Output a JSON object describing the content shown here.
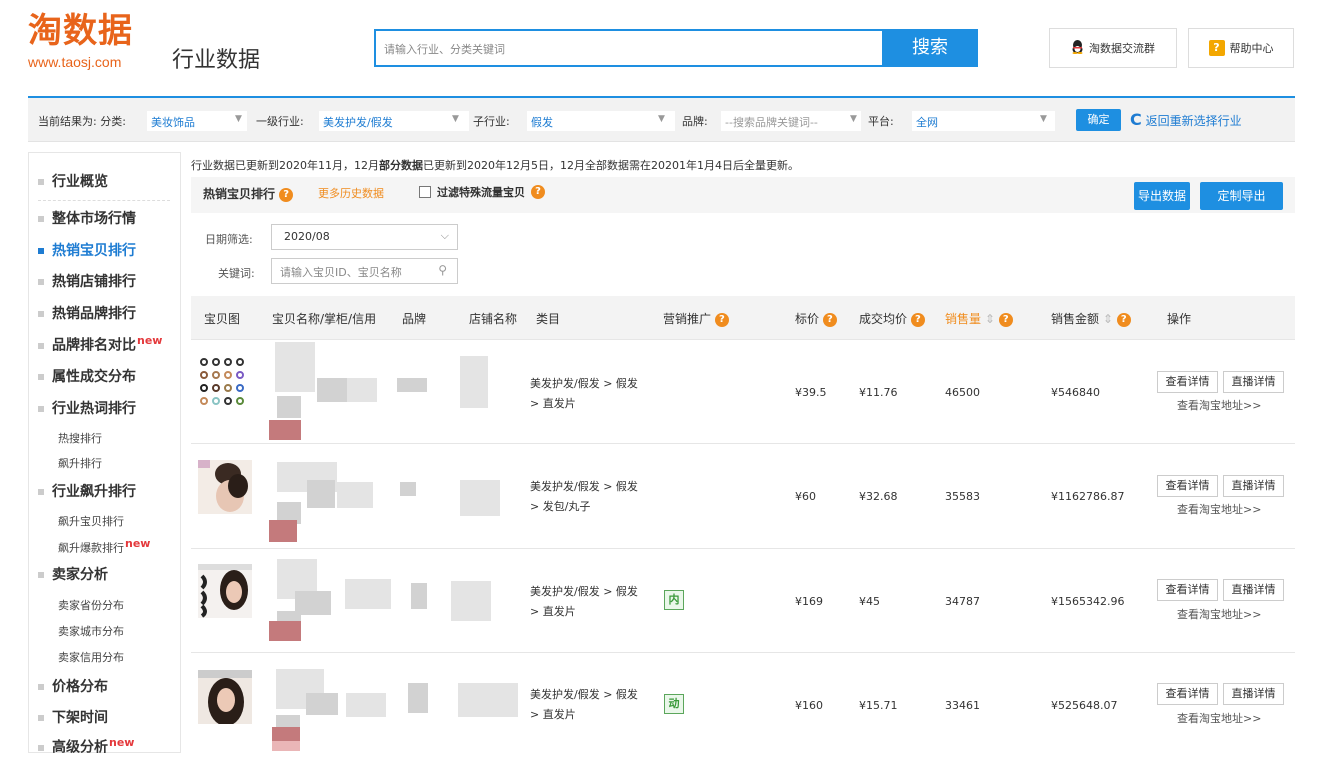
{
  "header": {
    "logo_main": "淘数据",
    "logo_url": "www.taosj.com",
    "logo_sub": "行业数据",
    "search_placeholder": "请输入行业、分类关键词",
    "search_button": "搜索",
    "qq_group": "淘数据交流群",
    "help_center": "帮助中心",
    "help_icon_glyph": "?"
  },
  "filter": {
    "current_label": "当前结果为: 分类:",
    "category": "美妆饰品",
    "level1_label": "一级行业:",
    "level1": "美发护发/假发",
    "sub_label": "子行业:",
    "sub": "假发",
    "brand_label": "品牌:",
    "brand_placeholder": "--搜索品牌关键词--",
    "platform_label": "平台:",
    "platform": "全网",
    "confirm": "确定",
    "return_label": "返回重新选择行业"
  },
  "sidebar": {
    "items": [
      {
        "label": "行业概览"
      },
      {
        "label": "整体市场行情"
      },
      {
        "label": "热销宝贝排行"
      },
      {
        "label": "热销店铺排行"
      },
      {
        "label": "热销品牌排行"
      },
      {
        "label": "品牌排名对比"
      },
      {
        "label": "属性成交分布"
      },
      {
        "label": "行业热词排行"
      },
      {
        "label": "行业飙升排行"
      },
      {
        "label": "卖家分析"
      },
      {
        "label": "价格分布"
      },
      {
        "label": "下架时间"
      },
      {
        "label": "高级分析"
      }
    ],
    "subs": [
      {
        "label": "热搜排行"
      },
      {
        "label": "飙升排行"
      },
      {
        "label": "飙升宝贝排行"
      },
      {
        "label": "飙升爆款排行"
      },
      {
        "label": "卖家省份分布"
      },
      {
        "label": "卖家城市分布"
      },
      {
        "label": "卖家信用分布"
      }
    ],
    "new_tag": "new"
  },
  "main": {
    "notice_a": "行业数据已更新到2020年11月，12月",
    "notice_b": "部分数据",
    "notice_c": "已更新到2020年12月5日，12月全部数据需在20201年1月4日后全量更新。",
    "panel_title": "热销宝贝排行",
    "more_history": "更多历史数据",
    "filter_special": "过滤特殊流量宝贝",
    "export": "导出数据",
    "custom_export": "定制导出",
    "date_label": "日期筛选:",
    "date_value": "2020/08",
    "keyword_label": "关键词:",
    "keyword_placeholder": "请输入宝贝ID、宝贝名称"
  },
  "table": {
    "headers": {
      "img": "宝贝图",
      "name": "宝贝名称/掌柜/信用",
      "brand": "品牌",
      "shop": "店铺名称",
      "category": "类目",
      "promo": "营销推广",
      "price": "标价",
      "avg_price": "成交均价",
      "sales": "销售量",
      "revenue": "销售金额",
      "action": "操作"
    },
    "rows": [
      {
        "cat1": "美发护发/假发 > 假发",
        "cat2": "> 直发片",
        "promo": "",
        "price": "¥39.5",
        "avg": "¥11.76",
        "sales": "46500",
        "revenue": "¥546840"
      },
      {
        "cat1": "美发护发/假发 > 假发",
        "cat2": "> 发包/丸子",
        "promo": "",
        "price": "¥60",
        "avg": "¥32.68",
        "sales": "35583",
        "revenue": "¥1162786.87"
      },
      {
        "cat1": "美发护发/假发 > 假发",
        "cat2": "> 直发片",
        "promo": "内",
        "price": "¥169",
        "avg": "¥45",
        "sales": "34787",
        "revenue": "¥1565342.96"
      },
      {
        "cat1": "美发护发/假发 > 假发",
        "cat2": "> 直发片",
        "promo": "动",
        "price": "¥160",
        "avg": "¥15.71",
        "sales": "33461",
        "revenue": "¥525648.07"
      }
    ],
    "view_detail": "查看详情",
    "live_detail": "直播详情",
    "taobao_link": "查看淘宝地址>>"
  },
  "colors": {
    "accent": "#1e8fe1",
    "orange": "#f08c1e",
    "red": "#e4393c"
  }
}
